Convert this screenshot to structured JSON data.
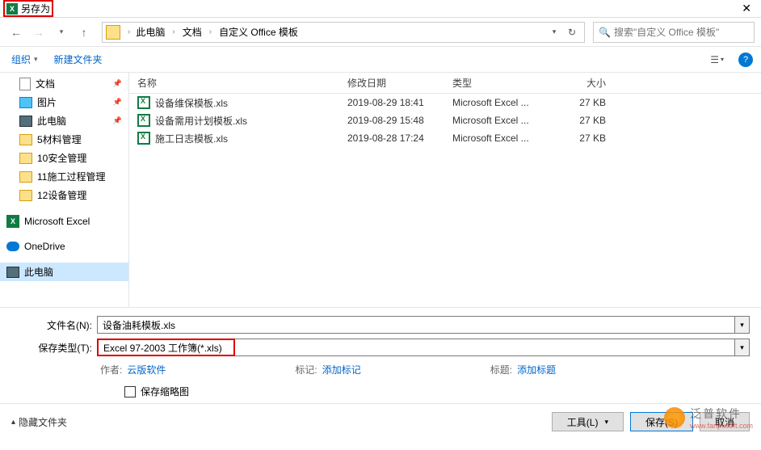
{
  "window": {
    "title": "另存为"
  },
  "breadcrumb": {
    "items": [
      "此电脑",
      "文档",
      "自定义 Office 模板"
    ]
  },
  "search": {
    "placeholder": "搜索\"自定义 Office 模板\""
  },
  "toolbar": {
    "organize": "组织",
    "new_folder": "新建文件夹"
  },
  "sidebar": {
    "items": [
      {
        "label": "文档",
        "type": "doc",
        "pinned": true
      },
      {
        "label": "图片",
        "type": "pic",
        "pinned": true
      },
      {
        "label": "此电脑",
        "type": "pc",
        "pinned": true
      },
      {
        "label": "5材料管理",
        "type": "folder",
        "indent": 1
      },
      {
        "label": "10安全管理",
        "type": "folder",
        "indent": 1
      },
      {
        "label": "11施工过程管理",
        "type": "folder",
        "indent": 1
      },
      {
        "label": "12设备管理",
        "type": "folder",
        "indent": 1
      },
      {
        "label": "Microsoft Excel",
        "type": "excel"
      },
      {
        "label": "OneDrive",
        "type": "onedrive"
      },
      {
        "label": "此电脑",
        "type": "pc",
        "selected": true
      }
    ]
  },
  "filelist": {
    "headers": {
      "name": "名称",
      "date": "修改日期",
      "type": "类型",
      "size": "大小"
    },
    "files": [
      {
        "name": "设备维保模板.xls",
        "date": "2019-08-29 18:41",
        "type": "Microsoft Excel ...",
        "size": "27 KB"
      },
      {
        "name": "设备需用计划模板.xls",
        "date": "2019-08-29 15:48",
        "type": "Microsoft Excel ...",
        "size": "27 KB"
      },
      {
        "name": "施工日志模板.xls",
        "date": "2019-08-28 17:24",
        "type": "Microsoft Excel ...",
        "size": "27 KB"
      }
    ]
  },
  "form": {
    "filename_label": "文件名(N):",
    "filename_value": "设备油耗模板.xls",
    "filetype_label": "保存类型(T):",
    "filetype_value": "Excel 97-2003 工作簿(*.xls)"
  },
  "meta": {
    "author_label": "作者:",
    "author_value": "云版软件",
    "tags_label": "标记:",
    "tags_value": "添加标记",
    "title_label": "标题:",
    "title_value": "添加标题"
  },
  "thumbnail": {
    "label": "保存缩略图"
  },
  "buttons": {
    "hide_folders": "隐藏文件夹",
    "tools": "工具(L)",
    "save": "保存(S)",
    "cancel": "取消"
  },
  "watermark": {
    "cn": "泛普软件",
    "en": "www.fanpusoft.com"
  }
}
